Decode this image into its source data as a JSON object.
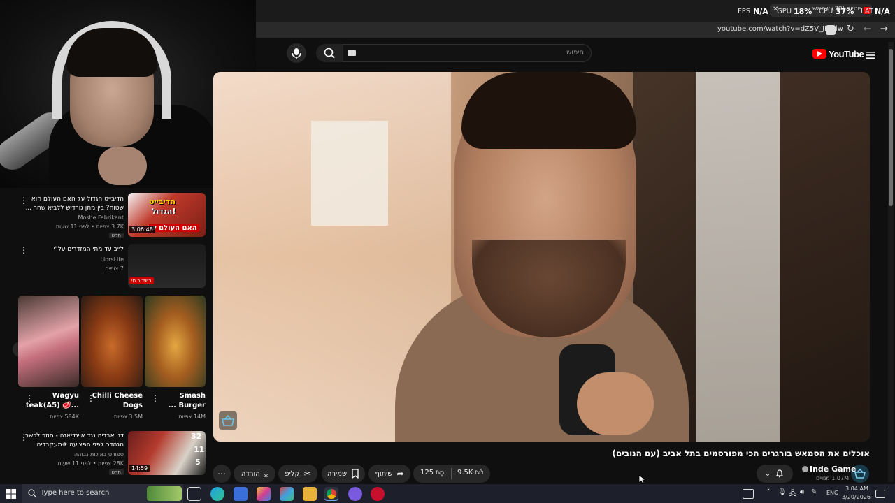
{
  "overlay": {
    "fps_label": "FPS",
    "fps_value": "N/A",
    "gpu_label": "GPU",
    "gpu_value": "18%",
    "cpu_label": "CPU",
    "cpu_value": "37%",
    "lat_label": "LAT",
    "lat_value": "N/A",
    "tab_title": "יוטיוב (39) שמאש"
  },
  "browser": {
    "url": "youtube.com/watch?v=dZ5V_JFUjlw"
  },
  "youtube": {
    "logo_text": "YouTube",
    "search_placeholder": "חיפוש"
  },
  "video": {
    "title": "אוכלים את הסמאש בורגרים הכי מפורסמים בתל אביב (עם הנובים)",
    "channel_name": "Inde Game",
    "subscribers": "1.07M מנויים",
    "likes": "9.5K",
    "dislikes": "125",
    "share_label": "שיתוף",
    "save_label": "שמירה",
    "clip_label": "קליפ",
    "download_label": "הורדה"
  },
  "sidebar": {
    "videos": [
      {
        "title_line1": "הדיבייט הגדול על האם העולם הוא",
        "title_line2": "שטוח? בין מתן גורדיש ללביא שחר ...",
        "channel": "Moshe Fabrikant",
        "meta": "3.7K צפיות • לפני 11 שעות",
        "badge": "חדש",
        "duration": "3:06:48",
        "thumb_text1": "הדיבייט",
        "thumb_text2": "הגדול!",
        "thumb_text3": "האם העולם ש"
      },
      {
        "title_line1": "לייב עד מתי המזדרים על\"י",
        "channel": "LiorsLife",
        "meta": "7 צופים",
        "live_badge": "בשידור חי"
      }
    ],
    "shorts": [
      {
        "title_line1": "Smash",
        "title_line2": "... Burger",
        "views": "14M צפיות"
      },
      {
        "title_line1": "Chilli Cheese",
        "title_line2": "Dogs",
        "views": "3.5M צפיות"
      },
      {
        "title_line1": "Wagyu",
        "title_line2": "teak(A5) 🥩...",
        "views": "584K צפיות"
      }
    ],
    "video3": {
      "title_line1": "דני אבדיה נגד איינדיאנה - חוזר לכשר",
      "title_line2": "הגהדר לפני הפציעה #מעקבדיה",
      "channel": "ספורט באיכות גבוהה",
      "meta": "28K צפיות • לפני 11 שעות",
      "badge": "חדש",
      "duration": "14:59",
      "score_top": "32",
      "score_mid": "11",
      "score_bot": "5"
    }
  },
  "taskbar": {
    "search_placeholder": "Type here to search",
    "language": "ENG",
    "time": "3:04 AM",
    "date": "3/20/2026"
  },
  "colors": {
    "yt_red": "#ff0000",
    "pill_bg": "#272727",
    "taskbar_bg": "#1d1f2b",
    "live_red": "#cc0000"
  }
}
